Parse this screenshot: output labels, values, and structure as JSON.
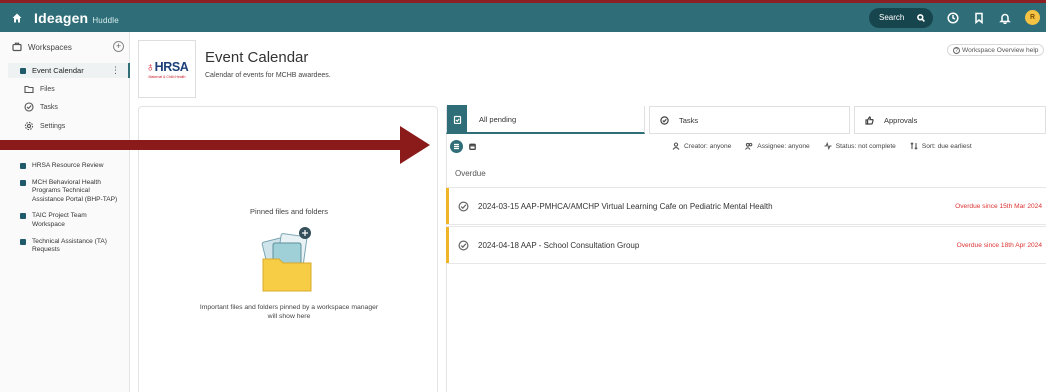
{
  "topbar": {
    "brand_name": "Ideagen",
    "brand_product": "Huddle",
    "search_label": "Search",
    "avatar_initial": "R"
  },
  "sidebar": {
    "workspaces_label": "Workspaces",
    "active_workspace": "Event Calendar",
    "sub_items": [
      {
        "label": "Files",
        "icon": "folder-icon"
      },
      {
        "label": "Tasks",
        "icon": "check-circle-icon"
      },
      {
        "label": "Settings",
        "icon": "gear-icon"
      }
    ],
    "workspaces": [
      {
        "label": "HRSA Resource Review"
      },
      {
        "label": "MCH Behavioral Health Programs Technical Assistance Portal (BHP-TAP)"
      },
      {
        "label": "TAIC Project Team Workspace"
      },
      {
        "label": "Technical Assistance (TA) Requests"
      }
    ]
  },
  "header": {
    "logo_text": "HRSA",
    "logo_subtext": "Maternal & Child Health",
    "title": "Event Calendar",
    "description": "Calendar of events for MCHB awardees.",
    "help_label": "Workspace Overview help"
  },
  "pinned": {
    "title": "Pinned files and folders",
    "description": "Important files and folders pinned by a workspace manager will show here"
  },
  "tabs": [
    {
      "label": "All pending",
      "icon": "clipboard-icon",
      "active": true
    },
    {
      "label": "Tasks",
      "icon": "check-circle-icon",
      "active": false
    },
    {
      "label": "Approvals",
      "icon": "thumbs-up-icon",
      "active": false
    }
  ],
  "filters": {
    "creator": "Creator: anyone",
    "assignee": "Assignee: anyone",
    "status": "Status: not complete",
    "sort": "Sort: due earliest"
  },
  "section_label": "Overdue",
  "tasks": [
    {
      "title": "2024-03-15 AAP-PMHCA/AMCHP Virtual Learning Cafe on Pediatric Mental Health",
      "due": "Overdue since 15th Mar 2024"
    },
    {
      "title": "2024-04-18 AAP - School Consultation Group",
      "due": "Overdue since 18th Apr 2024"
    }
  ],
  "colors": {
    "topbar": "#2f6e78",
    "stripe": "#8c1f23",
    "arrow": "#8b1a1a",
    "overdue_accent": "#f0b429",
    "overdue_text": "#dd3333"
  }
}
